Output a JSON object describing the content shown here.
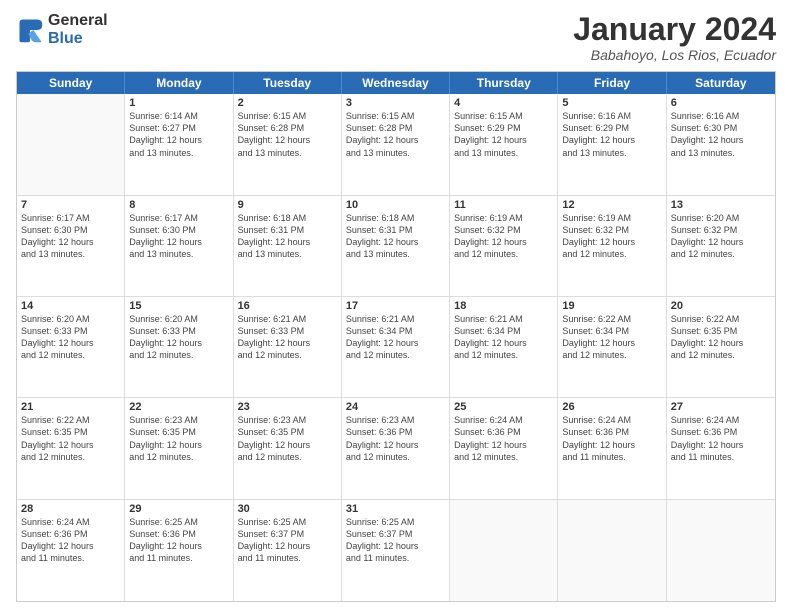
{
  "logo": {
    "general": "General",
    "blue": "Blue"
  },
  "title": "January 2024",
  "subtitle": "Babahoyo, Los Rios, Ecuador",
  "header_days": [
    "Sunday",
    "Monday",
    "Tuesday",
    "Wednesday",
    "Thursday",
    "Friday",
    "Saturday"
  ],
  "weeks": [
    [
      {
        "day": "",
        "info": ""
      },
      {
        "day": "1",
        "info": "Sunrise: 6:14 AM\nSunset: 6:27 PM\nDaylight: 12 hours\nand 13 minutes."
      },
      {
        "day": "2",
        "info": "Sunrise: 6:15 AM\nSunset: 6:28 PM\nDaylight: 12 hours\nand 13 minutes."
      },
      {
        "day": "3",
        "info": "Sunrise: 6:15 AM\nSunset: 6:28 PM\nDaylight: 12 hours\nand 13 minutes."
      },
      {
        "day": "4",
        "info": "Sunrise: 6:15 AM\nSunset: 6:29 PM\nDaylight: 12 hours\nand 13 minutes."
      },
      {
        "day": "5",
        "info": "Sunrise: 6:16 AM\nSunset: 6:29 PM\nDaylight: 12 hours\nand 13 minutes."
      },
      {
        "day": "6",
        "info": "Sunrise: 6:16 AM\nSunset: 6:30 PM\nDaylight: 12 hours\nand 13 minutes."
      }
    ],
    [
      {
        "day": "7",
        "info": "Sunrise: 6:17 AM\nSunset: 6:30 PM\nDaylight: 12 hours\nand 13 minutes."
      },
      {
        "day": "8",
        "info": "Sunrise: 6:17 AM\nSunset: 6:30 PM\nDaylight: 12 hours\nand 13 minutes."
      },
      {
        "day": "9",
        "info": "Sunrise: 6:18 AM\nSunset: 6:31 PM\nDaylight: 12 hours\nand 13 minutes."
      },
      {
        "day": "10",
        "info": "Sunrise: 6:18 AM\nSunset: 6:31 PM\nDaylight: 12 hours\nand 13 minutes."
      },
      {
        "day": "11",
        "info": "Sunrise: 6:19 AM\nSunset: 6:32 PM\nDaylight: 12 hours\nand 12 minutes."
      },
      {
        "day": "12",
        "info": "Sunrise: 6:19 AM\nSunset: 6:32 PM\nDaylight: 12 hours\nand 12 minutes."
      },
      {
        "day": "13",
        "info": "Sunrise: 6:20 AM\nSunset: 6:32 PM\nDaylight: 12 hours\nand 12 minutes."
      }
    ],
    [
      {
        "day": "14",
        "info": "Sunrise: 6:20 AM\nSunset: 6:33 PM\nDaylight: 12 hours\nand 12 minutes."
      },
      {
        "day": "15",
        "info": "Sunrise: 6:20 AM\nSunset: 6:33 PM\nDaylight: 12 hours\nand 12 minutes."
      },
      {
        "day": "16",
        "info": "Sunrise: 6:21 AM\nSunset: 6:33 PM\nDaylight: 12 hours\nand 12 minutes."
      },
      {
        "day": "17",
        "info": "Sunrise: 6:21 AM\nSunset: 6:34 PM\nDaylight: 12 hours\nand 12 minutes."
      },
      {
        "day": "18",
        "info": "Sunrise: 6:21 AM\nSunset: 6:34 PM\nDaylight: 12 hours\nand 12 minutes."
      },
      {
        "day": "19",
        "info": "Sunrise: 6:22 AM\nSunset: 6:34 PM\nDaylight: 12 hours\nand 12 minutes."
      },
      {
        "day": "20",
        "info": "Sunrise: 6:22 AM\nSunset: 6:35 PM\nDaylight: 12 hours\nand 12 minutes."
      }
    ],
    [
      {
        "day": "21",
        "info": "Sunrise: 6:22 AM\nSunset: 6:35 PM\nDaylight: 12 hours\nand 12 minutes."
      },
      {
        "day": "22",
        "info": "Sunrise: 6:23 AM\nSunset: 6:35 PM\nDaylight: 12 hours\nand 12 minutes."
      },
      {
        "day": "23",
        "info": "Sunrise: 6:23 AM\nSunset: 6:35 PM\nDaylight: 12 hours\nand 12 minutes."
      },
      {
        "day": "24",
        "info": "Sunrise: 6:23 AM\nSunset: 6:36 PM\nDaylight: 12 hours\nand 12 minutes."
      },
      {
        "day": "25",
        "info": "Sunrise: 6:24 AM\nSunset: 6:36 PM\nDaylight: 12 hours\nand 12 minutes."
      },
      {
        "day": "26",
        "info": "Sunrise: 6:24 AM\nSunset: 6:36 PM\nDaylight: 12 hours\nand 11 minutes."
      },
      {
        "day": "27",
        "info": "Sunrise: 6:24 AM\nSunset: 6:36 PM\nDaylight: 12 hours\nand 11 minutes."
      }
    ],
    [
      {
        "day": "28",
        "info": "Sunrise: 6:24 AM\nSunset: 6:36 PM\nDaylight: 12 hours\nand 11 minutes."
      },
      {
        "day": "29",
        "info": "Sunrise: 6:25 AM\nSunset: 6:36 PM\nDaylight: 12 hours\nand 11 minutes."
      },
      {
        "day": "30",
        "info": "Sunrise: 6:25 AM\nSunset: 6:37 PM\nDaylight: 12 hours\nand 11 minutes."
      },
      {
        "day": "31",
        "info": "Sunrise: 6:25 AM\nSunset: 6:37 PM\nDaylight: 12 hours\nand 11 minutes."
      },
      {
        "day": "",
        "info": ""
      },
      {
        "day": "",
        "info": ""
      },
      {
        "day": "",
        "info": ""
      }
    ]
  ]
}
